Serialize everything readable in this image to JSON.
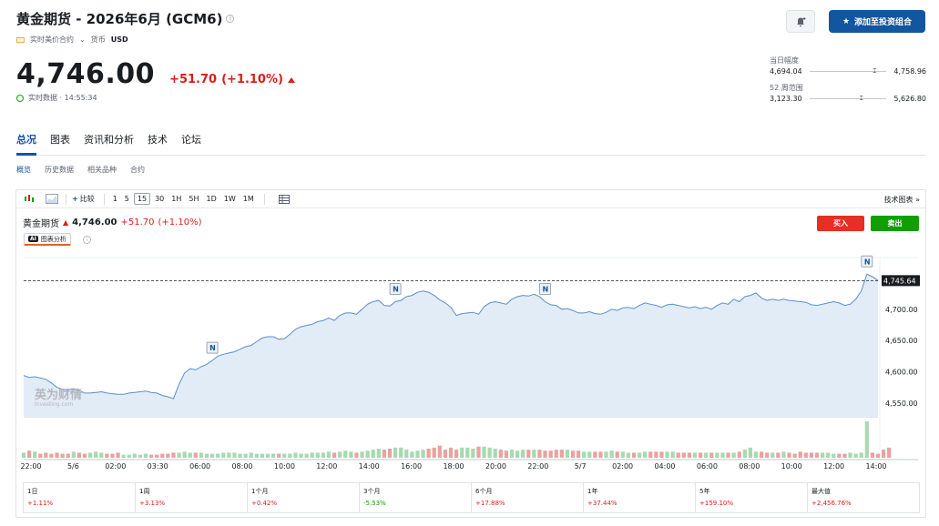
{
  "header": {
    "title": "黄金期货 - 2026年6月 (GCM6)",
    "contract_label": "实时美价合约",
    "currency_label": "货币",
    "currency": "USD",
    "add_portfolio": "添加至投资组合"
  },
  "quote": {
    "price": "4,746.00",
    "change": "+51.70",
    "change_pct": "(+1.10%)",
    "realtime": "实时数据 · 14:55:34"
  },
  "ranges": {
    "day": {
      "label": "当日幅度",
      "low": "4,694.04",
      "high": "4,758.96",
      "position": 0.82
    },
    "week52": {
      "label": "52 周范围",
      "low": "3,123.30",
      "high": "5,626.80",
      "position": 0.65
    }
  },
  "tabs": [
    "总况",
    "图表",
    "资讯和分析",
    "技术",
    "论坛"
  ],
  "subtabs": [
    "概览",
    "历史数据",
    "相关品种",
    "合约"
  ],
  "toolbar": {
    "compare": "比较",
    "intervals": [
      "1",
      "5",
      "15",
      "30",
      "1H",
      "5H",
      "1D",
      "1W",
      "1M"
    ],
    "active_interval": "15",
    "tech_chart": "技术图表 »"
  },
  "instrument": {
    "name": "黄金期货",
    "price": "4,746.00",
    "change": "+51.70",
    "change_pct": "(+1.10%)"
  },
  "ai_analysis": "图表分析",
  "buy": "买入",
  "sell": "卖出",
  "watermark": {
    "main": "英为财情",
    "sub": "Investing.com"
  },
  "news_marker": "N",
  "chart_data": {
    "type": "area",
    "y_ticks": [
      "4,700.00",
      "4,650.00",
      "4,600.00",
      "4,550.00"
    ],
    "y_tick_values": [
      4700,
      4650,
      4600,
      4550
    ],
    "ylim": [
      4528,
      4768
    ],
    "last_price": 4745.64,
    "last_label": "4,745.64",
    "x_labels": [
      "22:00",
      "5/6",
      "02:00",
      "03:30",
      "06:00",
      "08:00",
      "10:00",
      "12:00",
      "14:00",
      "16:00",
      "18:00",
      "20:00",
      "22:00",
      "5/7",
      "02:00",
      "04:00",
      "06:00",
      "08:00",
      "10:00",
      "12:00",
      "14:00"
    ],
    "values": [
      4594,
      4591,
      4592,
      4590,
      4588,
      4582,
      4575,
      4572,
      4571,
      4573,
      4570,
      4566,
      4566,
      4567,
      4568,
      4566,
      4565,
      4564,
      4564,
      4566,
      4567,
      4568,
      4569,
      4567,
      4566,
      4562,
      4560,
      4557,
      4580,
      4598,
      4605,
      4603,
      4608,
      4612,
      4618,
      4625,
      4628,
      4630,
      4632,
      4636,
      4640,
      4642,
      4648,
      4654,
      4656,
      4656,
      4652,
      4653,
      4660,
      4668,
      4672,
      4674,
      4676,
      4680,
      4682,
      4686,
      4682,
      4690,
      4694,
      4694,
      4692,
      4700,
      4708,
      4712,
      4714,
      4706,
      4705,
      4712,
      4714,
      4720,
      4722,
      4727,
      4729,
      4727,
      4722,
      4715,
      4710,
      4703,
      4690,
      4693,
      4694,
      4695,
      4692,
      4704,
      4710,
      4712,
      4710,
      4708,
      4716,
      4720,
      4722,
      4721,
      4724,
      4720,
      4712,
      4707,
      4706,
      4700,
      4701,
      4698,
      4694,
      4694,
      4696,
      4693,
      4692,
      4695,
      4700,
      4698,
      4702,
      4703,
      4701,
      4706,
      4710,
      4708,
      4706,
      4703,
      4707,
      4708,
      4706,
      4704,
      4702,
      4704,
      4701,
      4703,
      4700,
      4706,
      4710,
      4708,
      4716,
      4712,
      4720,
      4722,
      4726,
      4718,
      4714,
      4716,
      4714,
      4716,
      4714,
      4713,
      4712,
      4711,
      4707,
      4706,
      4708,
      4710,
      4712,
      4710,
      4706,
      4708,
      4716,
      4729,
      4756,
      4752,
      4746
    ],
    "volumes": [
      5,
      7,
      6,
      4,
      5,
      4,
      5,
      4,
      4,
      6,
      5,
      4,
      5,
      6,
      5,
      4,
      4,
      5,
      3,
      3,
      4,
      3,
      4,
      3,
      3,
      4,
      4,
      5,
      5,
      6,
      5,
      5,
      5,
      4,
      4,
      4,
      5,
      5,
      5,
      4,
      4,
      5,
      4,
      4,
      4,
      4,
      4,
      4,
      4,
      5,
      4,
      4,
      5,
      5,
      5,
      6,
      5,
      6,
      7,
      6,
      5,
      6,
      7,
      8,
      9,
      8,
      9,
      10,
      10,
      8,
      6,
      7,
      8,
      9,
      10,
      12,
      8,
      10,
      8,
      10,
      10,
      9,
      11,
      11,
      10,
      9,
      8,
      7,
      8,
      7,
      8,
      8,
      8,
      8,
      7,
      7,
      8,
      8,
      8,
      7,
      7,
      6,
      6,
      6,
      6,
      6,
      7,
      6,
      6,
      5,
      5,
      5,
      6,
      6,
      6,
      6,
      6,
      6,
      5,
      5,
      5,
      5,
      5,
      5,
      5,
      5,
      5,
      5,
      5,
      6,
      8,
      10,
      6,
      6,
      5,
      5,
      5,
      6,
      5,
      4,
      6,
      5,
      5,
      5,
      5,
      5,
      4,
      4,
      4,
      5,
      4,
      5,
      36,
      5,
      4,
      8,
      10
    ],
    "news_points": [
      34,
      67,
      94,
      152
    ],
    "grid": true
  },
  "performance": [
    {
      "label": "1日",
      "value": "+1.11%",
      "dir": "up"
    },
    {
      "label": "1周",
      "value": "+3.13%",
      "dir": "up"
    },
    {
      "label": "1个月",
      "value": "+0.42%",
      "dir": "up"
    },
    {
      "label": "3个月",
      "value": "-5.53%",
      "dir": "down"
    },
    {
      "label": "6个月",
      "value": "+17.88%",
      "dir": "up"
    },
    {
      "label": "1年",
      "value": "+37.44%",
      "dir": "up"
    },
    {
      "label": "5年",
      "value": "+159.10%",
      "dir": "up"
    },
    {
      "label": "最大值",
      "value": "+2,456.76%",
      "dir": "up"
    }
  ],
  "colors": {
    "up": "#d91e18",
    "down": "#0fa000",
    "accent": "#1256a0",
    "line": "#5b8fc7",
    "area": "#e2ecf6"
  }
}
